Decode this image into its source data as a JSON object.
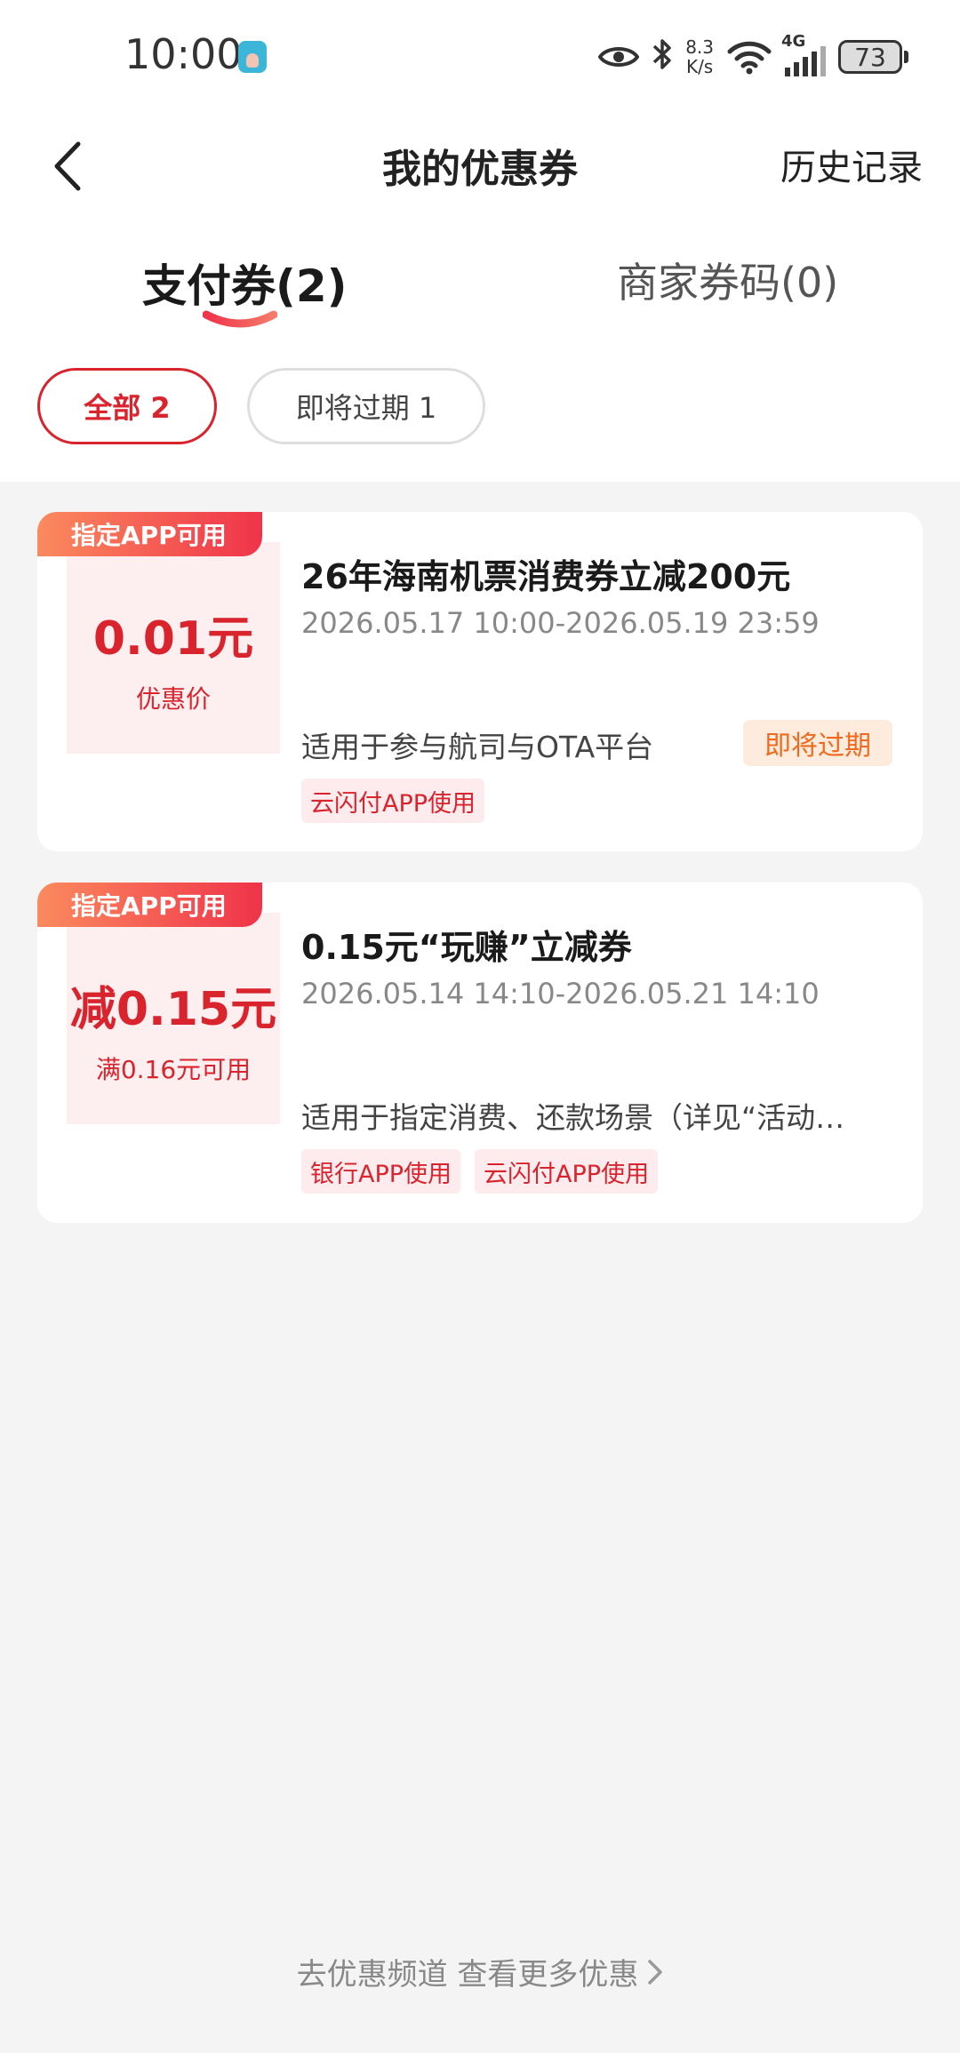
{
  "status_bar": {
    "time": "10:00",
    "net_speed_value": "8.3",
    "net_speed_unit": "K/s",
    "network_type": "4G",
    "battery": "73",
    "icons": [
      "app-notification-icon",
      "eye-icon",
      "bluetooth-icon",
      "wifi-icon",
      "signal-icon",
      "battery-icon"
    ]
  },
  "header": {
    "title": "我的优惠券",
    "history_label": "历史记录"
  },
  "tabs": [
    {
      "label": "支付券(2)",
      "active": true
    },
    {
      "label": "商家券码(0)",
      "active": false
    }
  ],
  "filters": [
    {
      "label": "全部 2",
      "active": true
    },
    {
      "label": "即将过期 1",
      "active": false
    }
  ],
  "coupons": [
    {
      "badge": "指定APP可用",
      "price_main": "0.01元",
      "price_sub": "优惠价",
      "title": "26年海南机票消费券立减200元",
      "date_range": "2026.05.17 10:00-2026.05.19 23:59",
      "description": "适用于参与航司与OTA平台",
      "status": "即将过期",
      "tags": [
        "云闪付APP使用"
      ]
    },
    {
      "badge": "指定APP可用",
      "price_main": "减0.15元",
      "price_sub": "满0.16元可用",
      "title": "0.15元“玩赚”立减券",
      "date_range": "2026.05.14 14:10-2026.05.21 14:10",
      "description": "适用于指定消费、还款场景（详见“活动…",
      "tags": [
        "银行APP使用",
        "云闪付APP使用"
      ]
    }
  ],
  "footer": {
    "link_label": "去优惠频道 查看更多优惠"
  },
  "colors": {
    "accent_red": "#d9242e",
    "warning_orange": "#f06a1d",
    "badge_gradient_start": "#fb8a5e",
    "badge_gradient_end": "#f0334a"
  }
}
